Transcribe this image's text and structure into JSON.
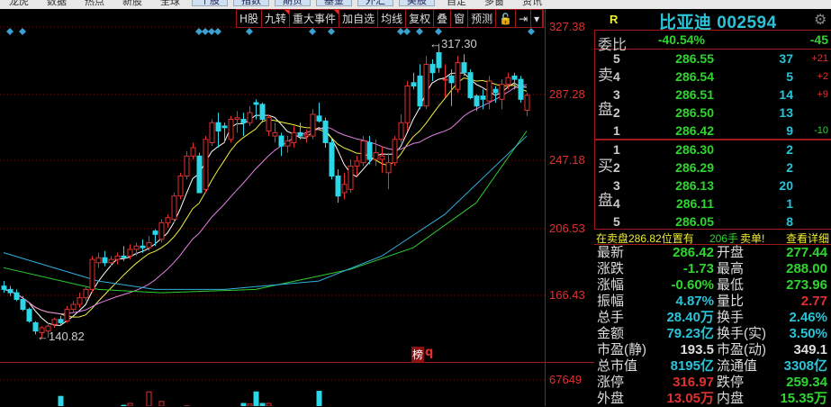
{
  "menubar": {
    "items": [
      "龙虎",
      "数据",
      "热点",
      "新股",
      "全球",
      "个股",
      "指数",
      "期货",
      "基金",
      "外汇",
      "美股",
      "自定",
      "多窗",
      "资讯"
    ]
  },
  "toolbar": {
    "items": [
      "H股",
      "九转",
      "重大事件",
      "加自选",
      "均线",
      "复权",
      "叠",
      "窗",
      "预测",
      "🔓",
      "⇥",
      "▾"
    ]
  },
  "price_axis": [
    "327.38",
    "287.28",
    "247.18",
    "206.53",
    "166.43"
  ],
  "volume_axis": "67649",
  "annotations": {
    "high_label": "317.30",
    "low_label": "140.82",
    "bang_badge": "榜",
    "bang_q": "q"
  },
  "colors": {
    "up": "#e03030",
    "down": "#2bd6e6",
    "ma5": "#ffffff",
    "ma10": "#f0f040",
    "ma20": "#e080e0",
    "ma60": "#30d030",
    "ma120": "#30b0e0",
    "grid": "#7a1010"
  },
  "chart_data": {
    "type": "candlestick",
    "ylim": [
      140,
      327.38
    ],
    "candles": [
      [
        172,
        175,
        168,
        170
      ],
      [
        170,
        172,
        166,
        168
      ],
      [
        168,
        170,
        163,
        164
      ],
      [
        164,
        166,
        157,
        158
      ],
      [
        158,
        159,
        150,
        151
      ],
      [
        150,
        151,
        143,
        145
      ],
      [
        144,
        148,
        140.82,
        147
      ],
      [
        145,
        150,
        141,
        148
      ],
      [
        149,
        153,
        147,
        152
      ],
      [
        152,
        154,
        148,
        150
      ],
      [
        151,
        160,
        150,
        158
      ],
      [
        158,
        163,
        156,
        161
      ],
      [
        161,
        168,
        159,
        165
      ],
      [
        165,
        172,
        163,
        170
      ],
      [
        170,
        190,
        168,
        188
      ],
      [
        186,
        192,
        183,
        189
      ],
      [
        189,
        193,
        184,
        186
      ],
      [
        186,
        190,
        184,
        188
      ],
      [
        188,
        192,
        185,
        190
      ],
      [
        190,
        196,
        187,
        189
      ],
      [
        190,
        197,
        188,
        194
      ],
      [
        194,
        198,
        190,
        196
      ],
      [
        196,
        200,
        192,
        195
      ],
      [
        195,
        202,
        193,
        198
      ],
      [
        205,
        206,
        196,
        203
      ],
      [
        200,
        212,
        198,
        210
      ],
      [
        210,
        215,
        207,
        213
      ],
      [
        212,
        228,
        210,
        226
      ],
      [
        226,
        240,
        224,
        238
      ],
      [
        238,
        253,
        236,
        250
      ],
      [
        250,
        258,
        248,
        255
      ],
      [
        250,
        252,
        228,
        228
      ],
      [
        230,
        262,
        228,
        260
      ],
      [
        258,
        272,
        256,
        270
      ],
      [
        270,
        276,
        255,
        265
      ],
      [
        268,
        270,
        258,
        267
      ],
      [
        260,
        274,
        258,
        272
      ],
      [
        272,
        277,
        264,
        273
      ],
      [
        272,
        276,
        262,
        270
      ],
      [
        270,
        280,
        268,
        276
      ],
      [
        282,
        284,
        272,
        281
      ],
      [
        281,
        282,
        270,
        272
      ],
      [
        265,
        275,
        262,
        273
      ],
      [
        262,
        270,
        258,
        264
      ],
      [
        262,
        264,
        250,
        256
      ],
      [
        256,
        262,
        252,
        259
      ],
      [
        258,
        268,
        255,
        264
      ],
      [
        264,
        270,
        260,
        262
      ],
      [
        262,
        266,
        258,
        263
      ],
      [
        262,
        278,
        260,
        275
      ],
      [
        274,
        282,
        270,
        271
      ],
      [
        271,
        273,
        255,
        258
      ],
      [
        258,
        260,
        236,
        238
      ],
      [
        238,
        242,
        222,
        226
      ],
      [
        228,
        240,
        224,
        233
      ],
      [
        230,
        248,
        228,
        244
      ],
      [
        244,
        250,
        238,
        247
      ],
      [
        246,
        262,
        244,
        259
      ],
      [
        258,
        262,
        245,
        248
      ],
      [
        248,
        260,
        244,
        252
      ],
      [
        248,
        256,
        240,
        250
      ],
      [
        240,
        252,
        230,
        246
      ],
      [
        246,
        262,
        244,
        260
      ],
      [
        260,
        275,
        258,
        270
      ],
      [
        270,
        295,
        265,
        292
      ],
      [
        294,
        300,
        290,
        292
      ],
      [
        298,
        305,
        278,
        280
      ],
      [
        280,
        310,
        278,
        305
      ],
      [
        305,
        308,
        295,
        300
      ],
      [
        312,
        317.3,
        300,
        303
      ],
      [
        296,
        305,
        285,
        296
      ],
      [
        298,
        302,
        280,
        294
      ],
      [
        290,
        310,
        288,
        306
      ],
      [
        306,
        311,
        298,
        300
      ],
      [
        300,
        302,
        284,
        285
      ],
      [
        286,
        287,
        277,
        280
      ],
      [
        286,
        290,
        278,
        284
      ],
      [
        283,
        298,
        278,
        295
      ],
      [
        290,
        292,
        282,
        288
      ],
      [
        284,
        296,
        278,
        293
      ],
      [
        293,
        300,
        290,
        297
      ],
      [
        298,
        300,
        290,
        296
      ],
      [
        296,
        298,
        282,
        284
      ],
      [
        277.44,
        288,
        273.96,
        286.42
      ]
    ],
    "ma60": [
      [
        0,
        183
      ],
      [
        15,
        170
      ],
      [
        25,
        168
      ],
      [
        40,
        170
      ],
      [
        55,
        182
      ],
      [
        65,
        195
      ],
      [
        75,
        222
      ],
      [
        83,
        265
      ]
    ],
    "ma120": [
      [
        0,
        192
      ],
      [
        15,
        175
      ],
      [
        24,
        170
      ],
      [
        35,
        170
      ],
      [
        50,
        175
      ],
      [
        60,
        190
      ],
      [
        70,
        215
      ],
      [
        83,
        262
      ]
    ],
    "volume": [
      22000,
      20000,
      21000,
      23000,
      24000,
      22000,
      20000,
      21000,
      23000,
      42000,
      22000,
      23000,
      24000,
      21000,
      25000,
      26000,
      22000,
      20000,
      21000,
      28000,
      31000,
      24000,
      23000,
      49000,
      22000,
      34000,
      24000,
      25000,
      26000,
      27000,
      23000,
      24000,
      25000,
      26000,
      24000,
      22000,
      23000,
      25000,
      31000,
      30000,
      49000,
      31000,
      31000,
      22000,
      23000,
      24000,
      22000,
      21000,
      25000,
      26000,
      50000,
      24000,
      23000,
      22000,
      21000,
      20000,
      22000,
      23000,
      24000,
      25000,
      26000,
      25000,
      24000,
      23000,
      25000,
      26000,
      24000,
      23000,
      22000,
      21000,
      22000,
      23000,
      24000,
      25000,
      22000,
      21000,
      22000,
      23000,
      22000,
      21000,
      22000,
      23000,
      22000,
      24000
    ],
    "volume_max": 67649,
    "event_markers": [
      1,
      3,
      31,
      32,
      33,
      34,
      39,
      49,
      52,
      63,
      64,
      66,
      69,
      84
    ]
  },
  "quote": {
    "r_label": "R",
    "title": "比亚迪 002594",
    "weibi_label": "委比",
    "weibi_pct": "-40.54%",
    "weibi_diff": "-45",
    "sell_label": "卖盘",
    "buy_label": "买盘",
    "asks": [
      {
        "level": "5",
        "price": "286.55",
        "vol": "37",
        "chg": "+21"
      },
      {
        "level": "4",
        "price": "286.54",
        "vol": "5",
        "chg": "+2"
      },
      {
        "level": "3",
        "price": "286.51",
        "vol": "14",
        "chg": "+9"
      },
      {
        "level": "2",
        "price": "286.50",
        "vol": "13",
        "chg": ""
      },
      {
        "level": "1",
        "price": "286.42",
        "vol": "9",
        "chg": "-10"
      }
    ],
    "bids": [
      {
        "level": "1",
        "price": "286.30",
        "vol": "2"
      },
      {
        "level": "2",
        "price": "286.29",
        "vol": "2"
      },
      {
        "level": "3",
        "price": "286.13",
        "vol": "20"
      },
      {
        "level": "4",
        "price": "286.11",
        "vol": "1"
      },
      {
        "level": "5",
        "price": "286.05",
        "vol": "8"
      }
    ],
    "notice": {
      "text": "在卖盘286.82位置有",
      "qty": "206手",
      "tail": "卖单!",
      "link": "查看详细"
    },
    "stats": [
      {
        "l1": "最新",
        "v1": "286.42",
        "c1": "green",
        "l2": "开盘",
        "v2": "277.44",
        "c2": "green"
      },
      {
        "l1": "涨跌",
        "v1": "-1.73",
        "c1": "green",
        "l2": "最高",
        "v2": "288.00",
        "c2": "green"
      },
      {
        "l1": "涨幅",
        "v1": "-0.60%",
        "c1": "green",
        "l2": "最低",
        "v2": "273.96",
        "c2": "green"
      },
      {
        "l1": "振幅",
        "v1": "4.87%",
        "c1": "cyan",
        "l2": "量比",
        "v2": "2.77",
        "c2": "red"
      },
      {
        "l1": "总手",
        "v1": "28.40万",
        "c1": "cyan",
        "l2": "换手",
        "v2": "2.46%",
        "c2": "cyan"
      },
      {
        "l1": "金额",
        "v1": "79.23亿",
        "c1": "cyan",
        "l2": "换手(实)",
        "v2": "3.50%",
        "c2": "cyan"
      },
      {
        "l1": "市盈(静)",
        "v1": "193.5",
        "c1": "white",
        "l2": "市盈(动)",
        "v2": "349.1",
        "c2": "white"
      },
      {
        "l1": "总市值",
        "v1": "8195亿",
        "c1": "cyan",
        "l2": "流通值",
        "v2": "3308亿",
        "c2": "cyan"
      },
      {
        "l1": "涨停",
        "v1": "316.97",
        "c1": "red",
        "l2": "跌停",
        "v2": "259.34",
        "c2": "green"
      },
      {
        "l1": "外盘",
        "v1": "13.05万",
        "c1": "red",
        "l2": "内盘",
        "v2": "15.35万",
        "c2": "green"
      }
    ]
  }
}
